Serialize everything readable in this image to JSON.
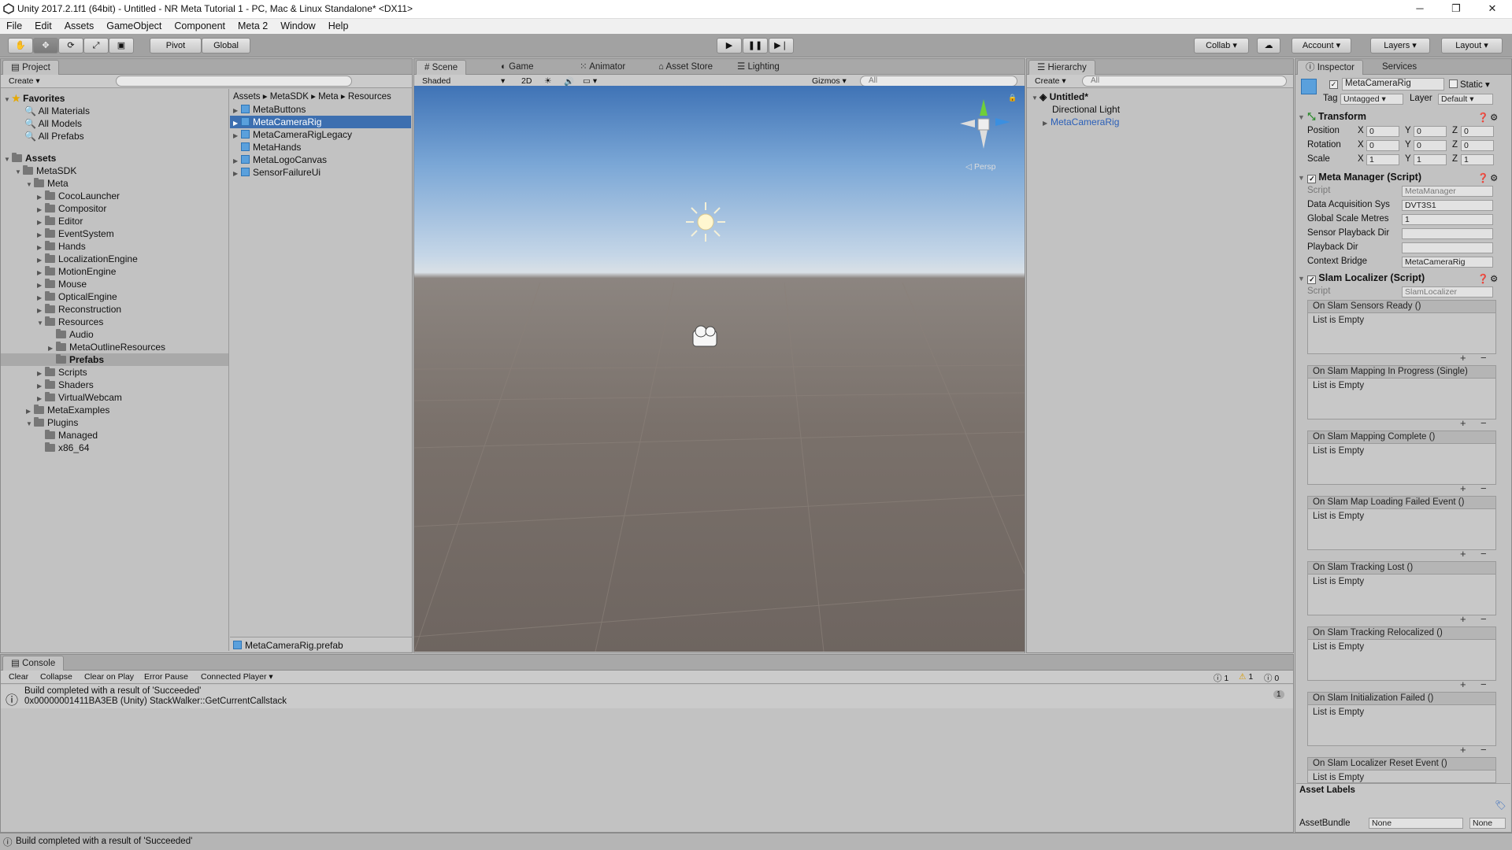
{
  "window": {
    "title": "Unity 2017.2.1f1 (64bit) - Untitled - NR Meta Tutorial 1 - PC, Mac & Linux Standalone* <DX11>",
    "minimize": "─",
    "restore": "❐",
    "close": "✕"
  },
  "menu": [
    "File",
    "Edit",
    "Assets",
    "GameObject",
    "Component",
    "Meta 2",
    "Window",
    "Help"
  ],
  "toolbar": {
    "pivot": "Pivot",
    "global": "Global",
    "collab": "Collab",
    "account": "Account",
    "layers": "Layers",
    "layout": "Layout"
  },
  "project": {
    "tab": "Project",
    "create": "Create",
    "favorites_label": "Favorites",
    "favorites": [
      "All Materials",
      "All Models",
      "All Prefabs"
    ],
    "assets_label": "Assets",
    "tree": [
      "MetaSDK",
      "Meta",
      "CocoLauncher",
      "Compositor",
      "Editor",
      "EventSystem",
      "Hands",
      "LocalizationEngine",
      "MotionEngine",
      "Mouse",
      "OpticalEngine",
      "Reconstruction",
      "Resources",
      "Audio",
      "MetaOutlineResources",
      "Prefabs",
      "Scripts",
      "Shaders",
      "VirtualWebcam",
      "MetaExamples",
      "Plugins",
      "Managed",
      "x86_64"
    ],
    "breadcrumb": [
      "Assets",
      "MetaSDK",
      "Meta",
      "Resources"
    ],
    "files": [
      "MetaButtons",
      "MetaCameraRig",
      "MetaCameraRigLegacy",
      "MetaHands",
      "MetaLogoCanvas",
      "SensorFailureUi"
    ],
    "selected_file": "MetaCameraRig.prefab"
  },
  "scene": {
    "tabs": [
      "Scene",
      "Game",
      "Animator",
      "Asset Store",
      "Lighting"
    ],
    "shaded": "Shaded",
    "mode2d": "2D",
    "gizmos": "Gizmos",
    "search": "All",
    "persp": "Persp"
  },
  "hierarchy": {
    "tab": "Hierarchy",
    "create": "Create",
    "search": "All",
    "scene_name": "Untitled*",
    "items": [
      "Directional Light",
      "MetaCameraRig"
    ]
  },
  "inspector": {
    "tabs": [
      "Inspector",
      "Services"
    ],
    "object_name": "MetaCameraRig",
    "static": "Static",
    "tag_label": "Tag",
    "tag": "Untagged",
    "layer_label": "Layer",
    "layer": "Default",
    "transform": {
      "title": "Transform",
      "rows": [
        {
          "label": "Position",
          "x": "0",
          "y": "0",
          "z": "0"
        },
        {
          "label": "Rotation",
          "x": "0",
          "y": "0",
          "z": "0"
        },
        {
          "label": "Scale",
          "x": "1",
          "y": "1",
          "z": "1"
        }
      ]
    },
    "meta_manager": {
      "title": "Meta Manager (Script)",
      "script_label": "Script",
      "script": "MetaManager",
      "rows": [
        {
          "label": "Data Acquisition Sys",
          "value": "DVT3S1"
        },
        {
          "label": "Global Scale Metres",
          "value": "1"
        },
        {
          "label": "Sensor Playback Dir",
          "value": ""
        },
        {
          "label": "Playback Dir",
          "value": ""
        },
        {
          "label": "Context Bridge",
          "value": "MetaCameraRig"
        }
      ]
    },
    "slam_localizer": {
      "title": "Slam Localizer (Script)",
      "script_label": "Script",
      "script": "SlamLocalizer",
      "events": [
        "On Slam Sensors Ready ()",
        "On Slam Mapping In Progress (Single)",
        "On Slam Mapping Complete ()",
        "On Slam Map Loading Failed Event ()",
        "On Slam Tracking Lost ()",
        "On Slam Tracking Relocalized ()",
        "On Slam Initialization Failed ()",
        "On Slam Localizer Reset Event ()"
      ],
      "empty_text": "List is Empty"
    },
    "asset_labels": "Asset Labels",
    "asset_bundle_label": "AssetBundle",
    "asset_bundle": "None",
    "asset_variant": "None"
  },
  "console": {
    "tab": "Console",
    "buttons": [
      "Clear",
      "Collapse",
      "Clear on Play",
      "Error Pause",
      "Connected Player"
    ],
    "count_info": "1",
    "count_warn": "1",
    "count_err": "0",
    "line1": "Build completed with a result of 'Succeeded'",
    "line2": "0x00000001411BA3EB (Unity) StackWalker::GetCurrentCallstack",
    "collapse_count": "1"
  },
  "statusbar": "Build completed with a result of 'Succeeded'"
}
